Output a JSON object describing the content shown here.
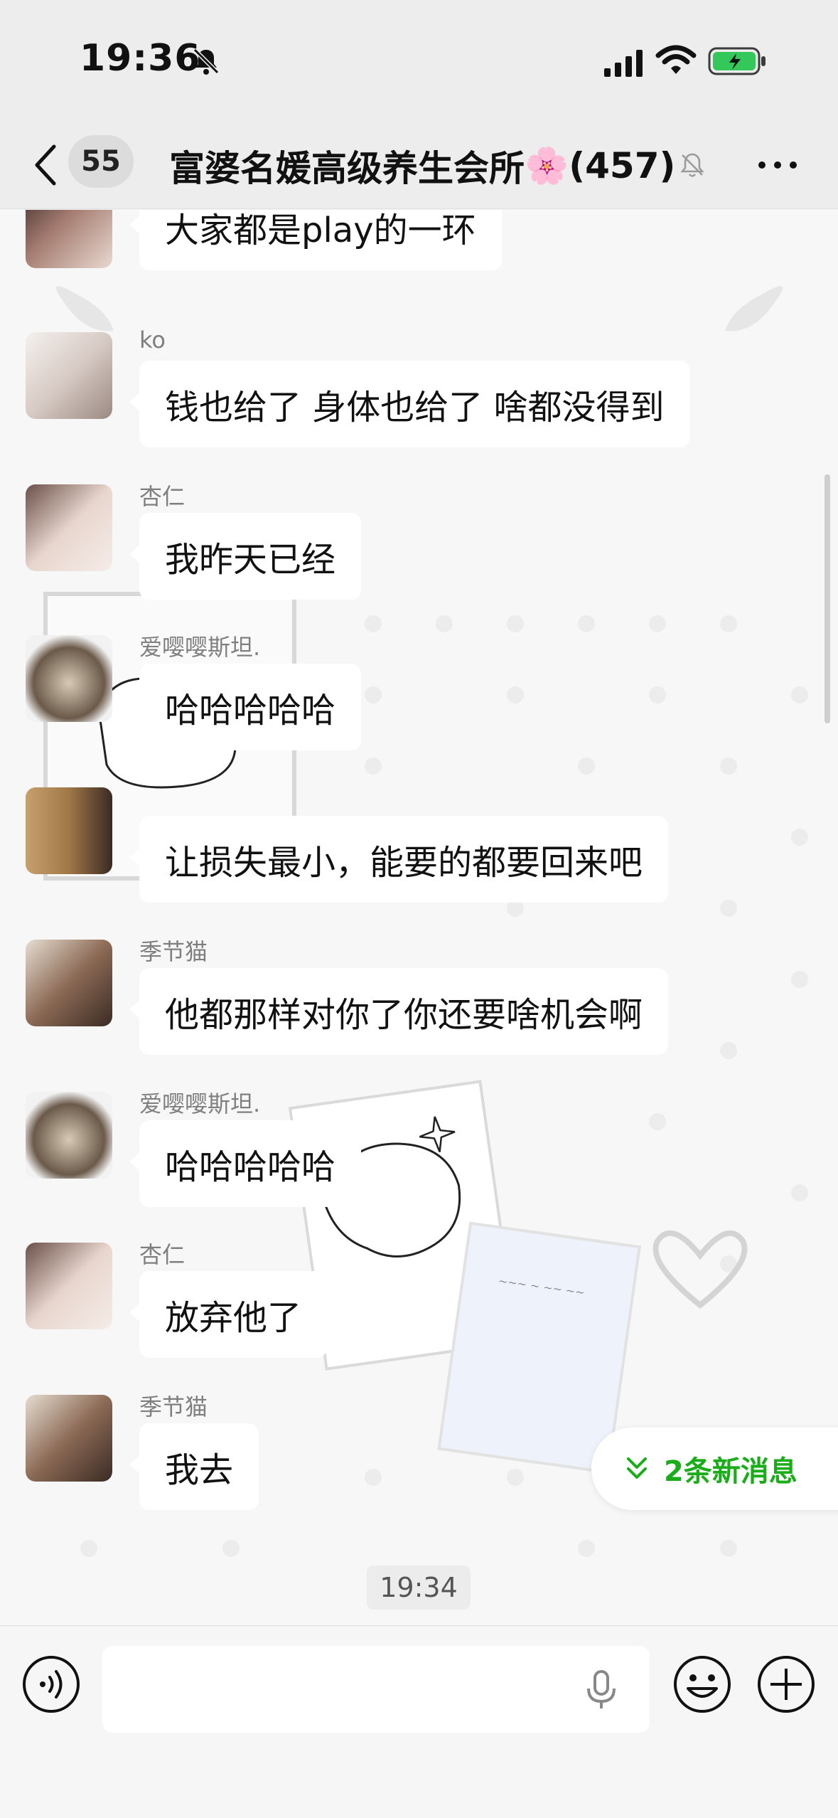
{
  "status_bar": {
    "time": "19:36",
    "icons": [
      "mute-icon",
      "cellular-signal-icon",
      "wifi-icon",
      "battery-charging-icon"
    ]
  },
  "nav": {
    "back_icon": "chevron-left-icon",
    "unread_count": "55",
    "title": "富婆名媛高级养生会所",
    "title_emoji": "🌸",
    "member_count": "(457)",
    "mute_icon": "bell-slash-icon",
    "more_icon": "more-dots-icon"
  },
  "messages": [
    {
      "sender": "",
      "text": "大家都是play的一环"
    },
    {
      "sender": "ko",
      "text": "钱也给了 身体也给了 啥都没得到"
    },
    {
      "sender": "杏仁",
      "text": "我昨天已经"
    },
    {
      "sender": "爱嘤嘤斯坦.",
      "text": "哈哈哈哈哈"
    },
    {
      "sender": "",
      "text": "让损失最小，能要的都要回来吧"
    },
    {
      "sender": "季节猫",
      "text": "他都那样对你了你还要啥机会啊"
    },
    {
      "sender": "爱嘤嘤斯坦.",
      "text": "哈哈哈哈哈"
    },
    {
      "sender": "杏仁",
      "text": "放弃他了"
    },
    {
      "sender": "季节猫",
      "text": "我去"
    }
  ],
  "new_messages_pill": "2条新消息",
  "time_tag": "19:34",
  "input": {
    "value": "",
    "placeholder": "",
    "icons": [
      "voice-icon",
      "microphone-icon",
      "emoji-icon",
      "plus-icon"
    ]
  },
  "colors": {
    "accent_green": "#1aad19",
    "bubble": "#ffffff",
    "background": "#f7f7f7"
  }
}
